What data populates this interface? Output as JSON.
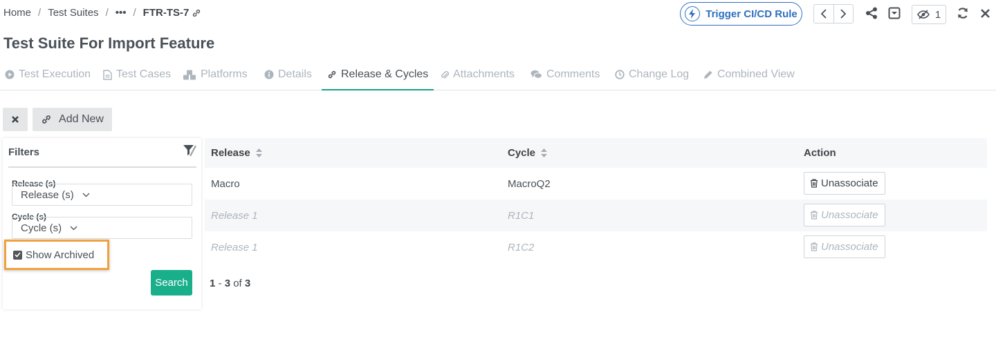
{
  "breadcrumb": {
    "home": "Home",
    "suites": "Test Suites",
    "ellipsis": "•••",
    "current": "FTR-TS-7"
  },
  "header": {
    "trigger_label": "Trigger CI/CD Rule",
    "watch_count": "1"
  },
  "page_title": "Test Suite For Import Feature",
  "tabs": [
    {
      "label": "Test Execution",
      "icon": "play-circle-icon"
    },
    {
      "label": "Test Cases",
      "icon": "document-icon"
    },
    {
      "label": "Platforms",
      "icon": "cubes-icon"
    },
    {
      "label": "Details",
      "icon": "info-icon"
    },
    {
      "label": "Release & Cycles",
      "icon": "link-icon",
      "active": true
    },
    {
      "label": "Attachments",
      "icon": "paperclip-icon"
    },
    {
      "label": "Comments",
      "icon": "comments-icon"
    },
    {
      "label": "Change Log",
      "icon": "clock-icon"
    },
    {
      "label": "Combined View",
      "icon": "pencil-icon"
    }
  ],
  "actions": {
    "add_new": "Add New"
  },
  "filters": {
    "title": "Filters",
    "release_label": "Release (s)",
    "release_value": "Release (s)",
    "cycle_label": "Cycle (s)",
    "cycle_value": "Cycle (s)",
    "show_archived": "Show Archived",
    "show_archived_checked": true,
    "search": "Search"
  },
  "table": {
    "columns": [
      "Release",
      "Cycle",
      "Action"
    ],
    "rows": [
      {
        "release": "Macro",
        "cycle": "MacroQ2",
        "action": "Unassociate",
        "archived": false
      },
      {
        "release": "Release 1",
        "cycle": "R1C1",
        "action": "Unassociate",
        "archived": true
      },
      {
        "release": "Release 1",
        "cycle": "R1C2",
        "action": "Unassociate",
        "archived": true
      }
    ]
  },
  "pager": {
    "from": "1",
    "to": "3",
    "of_word": "of",
    "total": "3"
  },
  "colors": {
    "accent": "#1aa085",
    "primary_blue": "#2f6fbf",
    "highlight": "#f2a03d",
    "search_btn": "#1aaf8b"
  }
}
